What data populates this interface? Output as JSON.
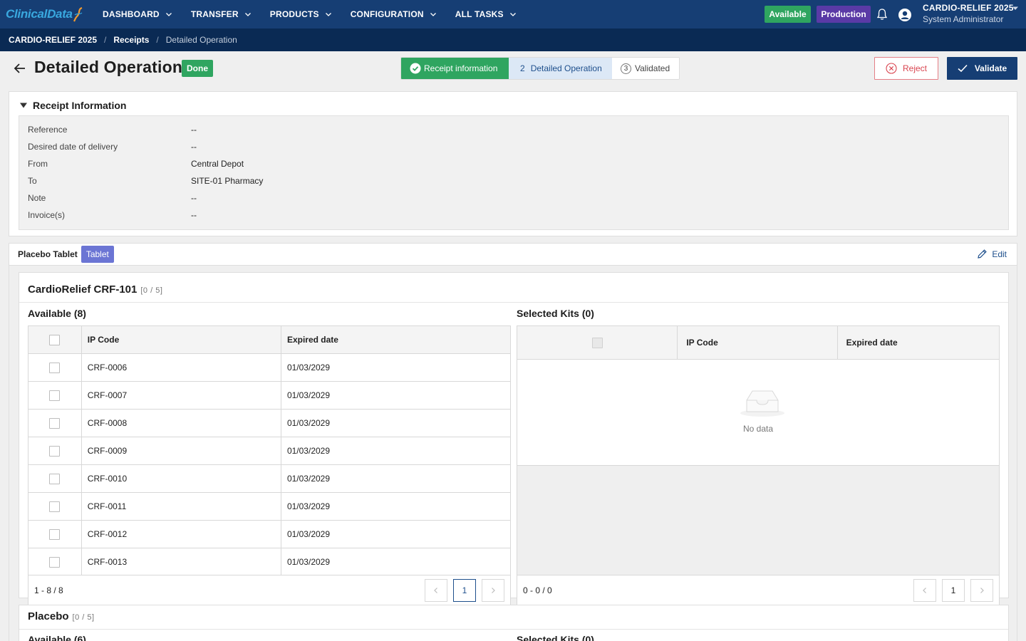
{
  "app": {
    "logo_text": "ClinicalData",
    "nav": [
      {
        "label": "DASHBOARD"
      },
      {
        "label": "TRANSFER"
      },
      {
        "label": "PRODUCTS"
      },
      {
        "label": "CONFIGURATION"
      },
      {
        "label": "ALL TASKS"
      }
    ],
    "badge_available": "Available",
    "badge_production": "Production",
    "user_study": "CARDIO-RELIEF 2025",
    "user_role": "System Administrator"
  },
  "breadcrumb": {
    "items": [
      "CARDIO-RELIEF 2025",
      "Receipts",
      "Detailed Operation"
    ],
    "separator": "/"
  },
  "header": {
    "title": "Detailed Operation",
    "status": "Done",
    "steps": [
      {
        "number": "",
        "label": "Receipt information"
      },
      {
        "number": "2",
        "label": "Detailed Operation"
      },
      {
        "number": "3",
        "label": "Validated"
      }
    ],
    "reject_label": "Reject",
    "validate_label": "Validate"
  },
  "receipt": {
    "title": "Receipt Information",
    "fields": [
      {
        "label": "Reference",
        "value": "--"
      },
      {
        "label": "Desired date of delivery",
        "value": "--"
      },
      {
        "label": "From",
        "value": "Central Depot"
      },
      {
        "label": "To",
        "value": "SITE-01 Pharmacy"
      },
      {
        "label": "Note",
        "value": "--"
      },
      {
        "label": "Invoice(s)",
        "value": "--"
      }
    ]
  },
  "product": {
    "name": "Placebo Tablet",
    "type": "Tablet",
    "edit_label": "Edit"
  },
  "kit1": {
    "title": "CardioRelief CRF-101",
    "count": "[0 / 5]",
    "available_title": "Available (8)",
    "selected_title": "Selected Kits (0)",
    "col_ip": "IP Code",
    "col_exp": "Expired date",
    "rows": [
      {
        "ip": "CRF-0006",
        "exp": "01/03/2029"
      },
      {
        "ip": "CRF-0007",
        "exp": "01/03/2029"
      },
      {
        "ip": "CRF-0008",
        "exp": "01/03/2029"
      },
      {
        "ip": "CRF-0009",
        "exp": "01/03/2029"
      },
      {
        "ip": "CRF-0010",
        "exp": "01/03/2029"
      },
      {
        "ip": "CRF-0011",
        "exp": "01/03/2029"
      },
      {
        "ip": "CRF-0012",
        "exp": "01/03/2029"
      },
      {
        "ip": "CRF-0013",
        "exp": "01/03/2029"
      }
    ],
    "available_range": "1 - 8 / 8",
    "available_page": "1",
    "selected_range": "0 - 0 / 0",
    "selected_page": "1",
    "empty_text": "No data"
  },
  "kit2": {
    "title": "Placebo",
    "count": "[0 / 5]",
    "available_title": "Available (6)",
    "selected_title": "Selected Kits (0)"
  },
  "colors": {
    "nav_bg": "#163e74",
    "crumb_bg": "#0a2a54",
    "success": "#2fa560",
    "production": "#5a3aa6",
    "reject": "#d9444f",
    "tablet_badge": "#6b75d4"
  }
}
